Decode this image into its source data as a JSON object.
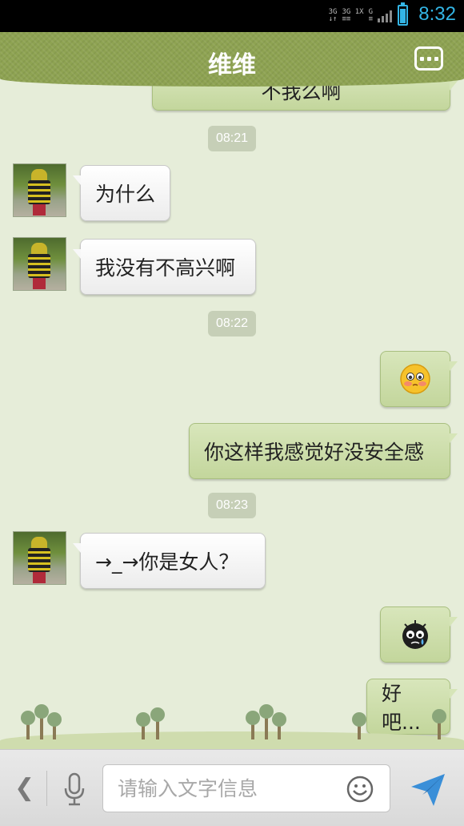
{
  "status_bar": {
    "network_left": "3G\n↓↑",
    "network_mid": "3G 1X\n≡",
    "network_right": "G",
    "time": "8:32"
  },
  "header": {
    "title": "维维",
    "menu_icon": "more-dots-icon"
  },
  "messages": [
    {
      "side": "right",
      "text": "不我么啊",
      "partial": true
    },
    {
      "side": "time",
      "text": "08:21"
    },
    {
      "side": "left",
      "text": "为什么"
    },
    {
      "side": "left",
      "text": "我没有不高兴啊"
    },
    {
      "side": "time",
      "text": "08:22"
    },
    {
      "side": "right",
      "emoji": "blushing-face-emoji"
    },
    {
      "side": "right",
      "text": "你这样我感觉好没安全感"
    },
    {
      "side": "time",
      "text": "08:23"
    },
    {
      "side": "left",
      "text": "→_→你是女人？"
    },
    {
      "side": "right",
      "emoji": "crying-black-face-emoji"
    },
    {
      "side": "right",
      "text": "好吧..."
    }
  ],
  "input_bar": {
    "placeholder": "请输入文字信息",
    "back_icon": "chevron-left-icon",
    "voice_icon": "microphone-icon",
    "emoji_icon": "smiley-icon",
    "send_icon": "send-plane-icon"
  },
  "colors": {
    "header": "#8ea352",
    "chat_background": "#e6edd9",
    "sent_bubble": "#cadca6",
    "received_bubble": "#f4f4f4",
    "accent": "#33b5e5"
  }
}
